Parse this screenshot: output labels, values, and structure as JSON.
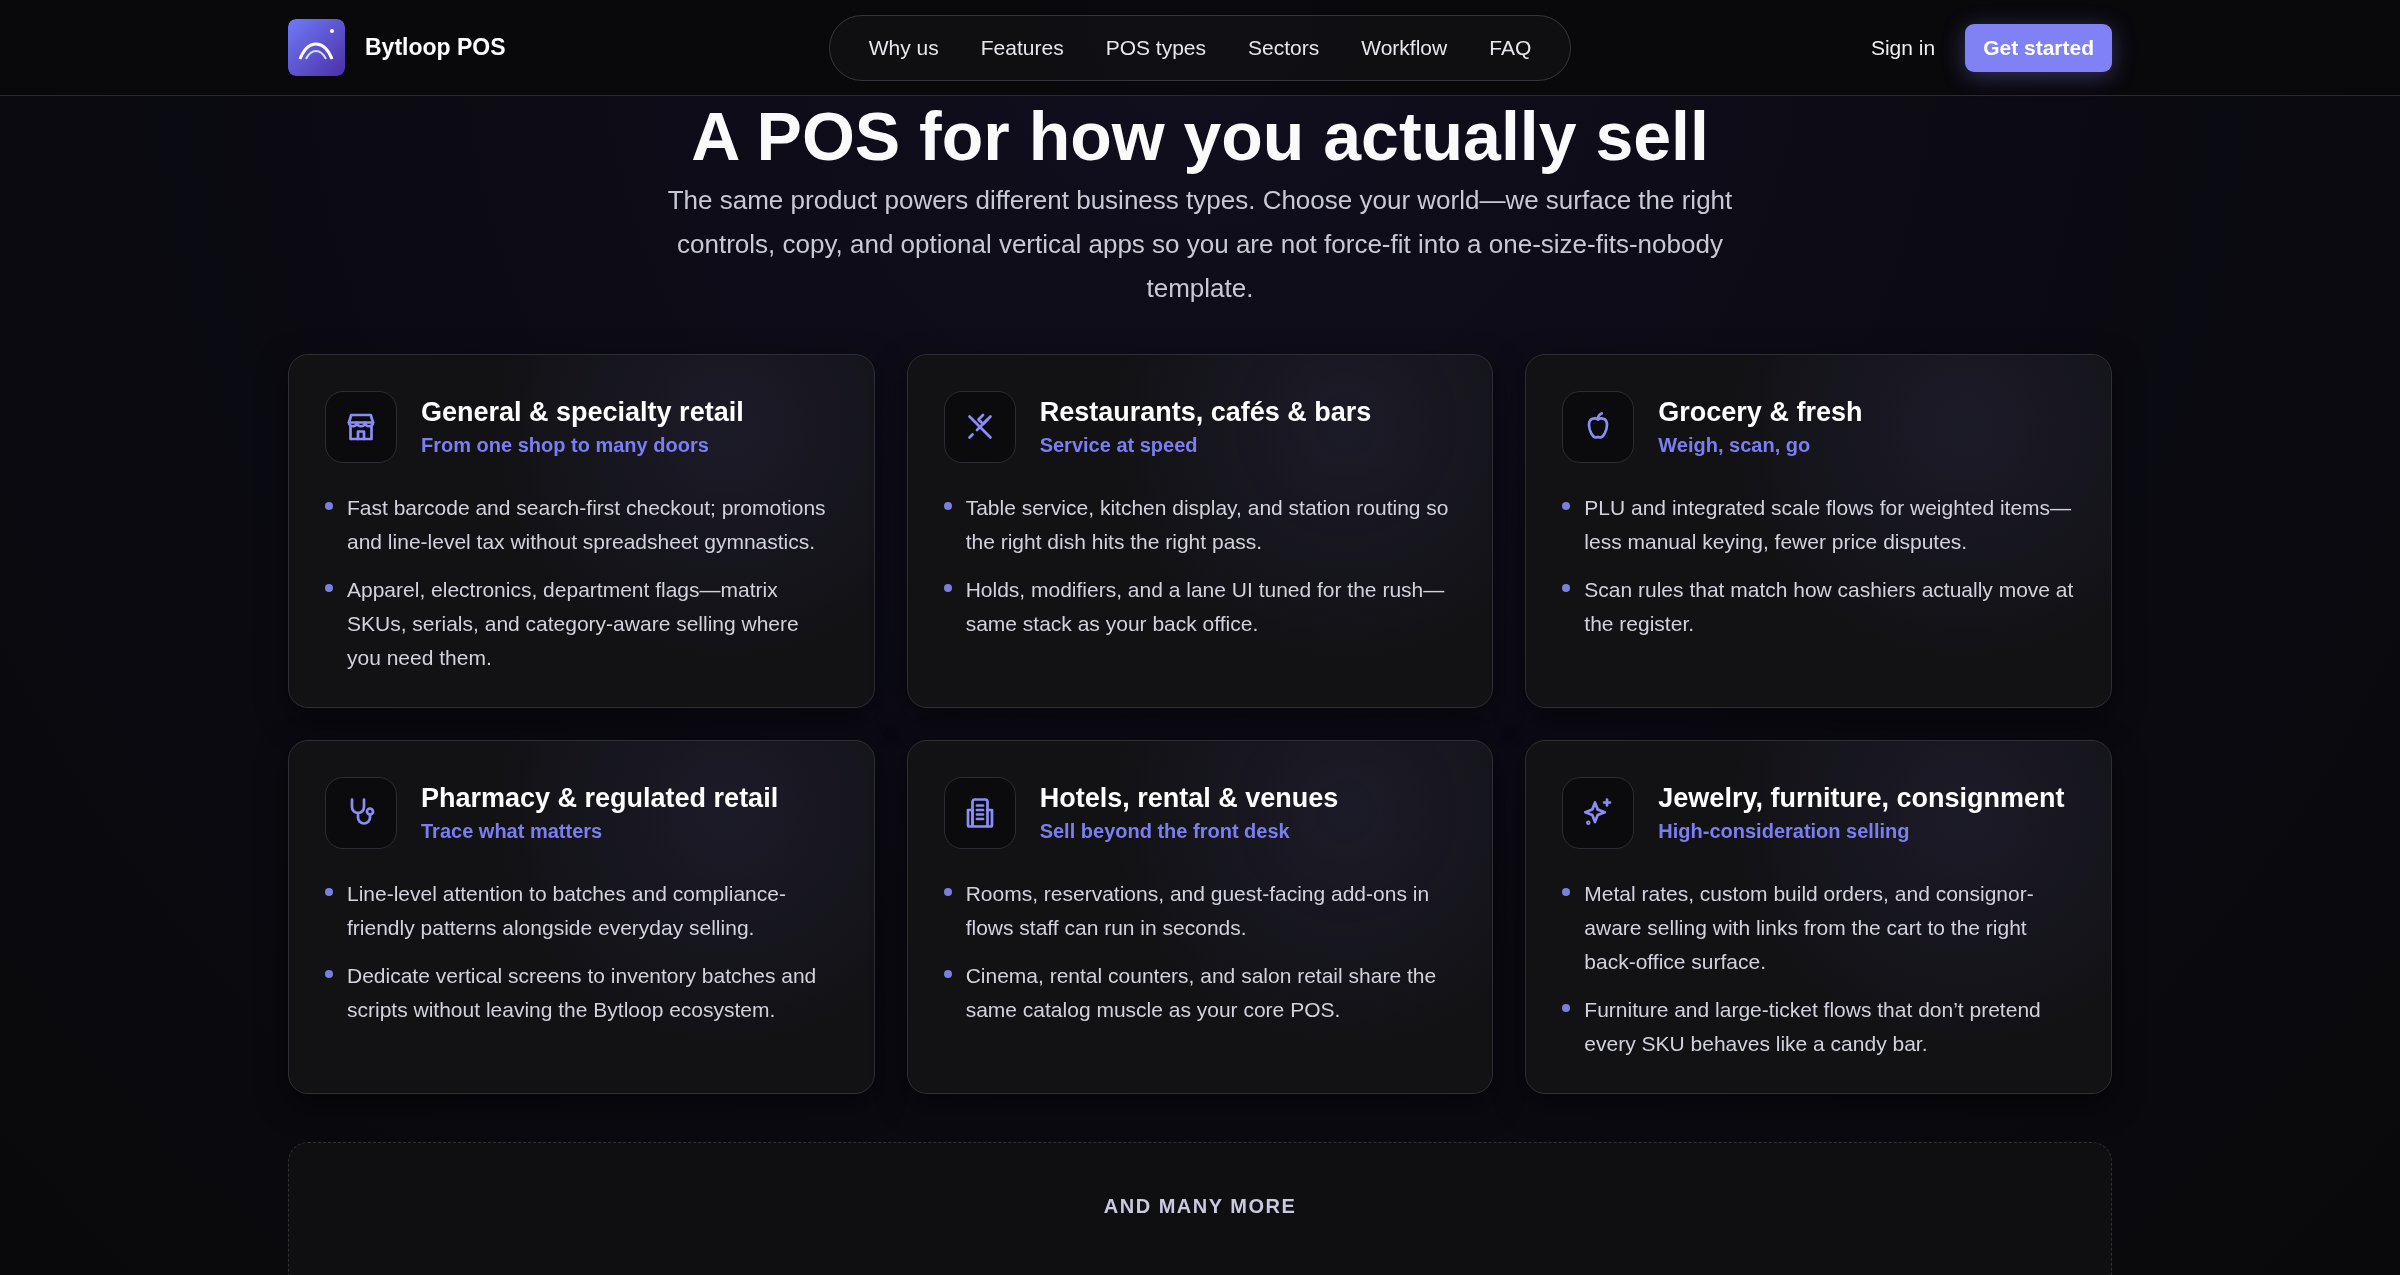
{
  "header": {
    "brand": "Bytloop POS",
    "nav": [
      {
        "label": "Why us"
      },
      {
        "label": "Features"
      },
      {
        "label": "POS types"
      },
      {
        "label": "Sectors"
      },
      {
        "label": "Workflow"
      },
      {
        "label": "FAQ"
      }
    ],
    "sign_in": "Sign in",
    "cta": "Get started"
  },
  "hero": {
    "title": "A POS for how you actually sell",
    "subtitle": "The same product powers different business types. Choose your world—we surface the right controls, copy, and optional vertical apps so you are not force-fit into a one-size-fits-nobody template."
  },
  "cards": [
    {
      "title": "General & specialty retail",
      "tagline": "From one shop to many doors",
      "bullets": [
        "Fast barcode and search-first checkout; promotions and line-level tax without spreadsheet gymnastics.",
        "Apparel, electronics, department flags—matrix SKUs, serials, and category-aware selling where you need them."
      ]
    },
    {
      "title": "Restaurants, cafés & bars",
      "tagline": "Service at speed",
      "bullets": [
        "Table service, kitchen display, and station routing so the right dish hits the right pass.",
        "Holds, modifiers, and a lane UI tuned for the rush—same stack as your back office."
      ]
    },
    {
      "title": "Grocery & fresh",
      "tagline": "Weigh, scan, go",
      "bullets": [
        "PLU and integrated scale flows for weighted items—less manual keying, fewer price disputes.",
        "Scan rules that match how cashiers actually move at the register."
      ]
    },
    {
      "title": "Pharmacy & regulated retail",
      "tagline": "Trace what matters",
      "bullets": [
        "Line-level attention to batches and compliance-friendly patterns alongside everyday selling.",
        "Dedicate vertical screens to inventory batches and scripts without leaving the Bytloop ecosystem."
      ]
    },
    {
      "title": "Hotels, rental & venues",
      "tagline": "Sell beyond the front desk",
      "bullets": [
        "Rooms, reservations, and guest-facing add-ons in flows staff can run in seconds.",
        "Cinema, rental counters, and salon retail share the same catalog muscle as your core POS."
      ]
    },
    {
      "title": "Jewelry, furniture, consignment",
      "tagline": "High-consideration selling",
      "bullets": [
        "Metal rates, custom build orders, and consignor-aware selling with links from the cart to the right back-office surface.",
        "Furniture and large-ticket flows that don’t pretend every SKU behaves like a candy bar."
      ]
    }
  ],
  "more": {
    "heading": "AND MANY MORE"
  }
}
